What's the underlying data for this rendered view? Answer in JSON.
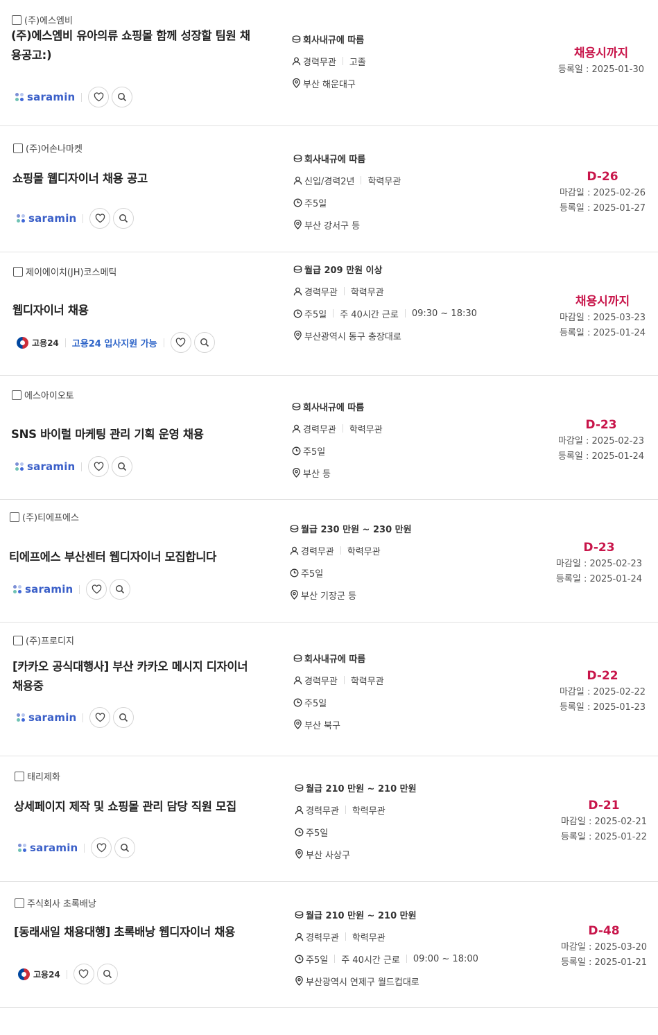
{
  "accent_color": "#c8154a",
  "jobs": [
    {
      "company": "(주)에스엠비",
      "title_lines": [
        "(주)에스엠비 유아의류 쇼핑몰 함께 성장할 팀원 채",
        "용공고:)"
      ],
      "source": "saramin",
      "source_label": "saramin",
      "salary": "회사내규에 따름",
      "career": "경력무관",
      "education": "고졸",
      "schedule": null,
      "location": "부산 해운대구",
      "dday": "채용시까지",
      "deadline": null,
      "registered": "등록일 : 2025-01-30"
    },
    {
      "company": "(주)어손나마켓",
      "title_lines": [
        "쇼핑몰 웹디자이너 채용 공고"
      ],
      "source": "saramin",
      "source_label": "saramin",
      "salary": "회사내규에 따름",
      "career": "신입/경력2년",
      "education": "학력무관",
      "schedule": [
        "주5일"
      ],
      "location": "부산 강서구 등",
      "dday": "D-26",
      "deadline": "마감일 : 2025-02-26",
      "registered": "등록일 : 2025-01-27"
    },
    {
      "company": "제이에이치(JH)코스메틱",
      "title_lines": [
        "웹디자이너 채용"
      ],
      "source": "goyong",
      "source_label": "고용24",
      "support_label": "고용24 입사지원 가능",
      "salary": "월급 209 만원 이상",
      "career": "경력무관",
      "education": "학력무관",
      "schedule": [
        "주5일",
        "주 40시간 근로",
        "09:30 ~ 18:30"
      ],
      "location": "부산광역시 동구 충장대로",
      "dday": "채용시까지",
      "deadline": "마감일 : 2025-03-23",
      "registered": "등록일 : 2025-01-24"
    },
    {
      "company": "에스아이오토",
      "title_lines": [
        "SNS 바이럴 마케팅 관리 기획 운영 채용"
      ],
      "source": "saramin",
      "source_label": "saramin",
      "salary": "회사내규에 따름",
      "career": "경력무관",
      "education": "학력무관",
      "schedule": [
        "주5일"
      ],
      "location": "부산 등",
      "dday": "D-23",
      "deadline": "마감일 : 2025-02-23",
      "registered": "등록일 : 2025-01-24"
    },
    {
      "company": "(주)티에프에스",
      "title_lines": [
        "티에프에스 부산센터 웹디자이너 모집합니다"
      ],
      "source": "saramin",
      "source_label": "saramin",
      "salary": "월급 230 만원 ~ 230 만원",
      "career": "경력무관",
      "education": "학력무관",
      "schedule": [
        "주5일"
      ],
      "location": "부산 기장군 등",
      "dday": "D-23",
      "deadline": "마감일 : 2025-02-23",
      "registered": "등록일 : 2025-01-24"
    },
    {
      "company": "(주)프로디지",
      "title_lines": [
        "[카카오 공식대행사] 부산 카카오 메시지 디자이너",
        "채용중"
      ],
      "source": "saramin",
      "source_label": "saramin",
      "salary": "회사내규에 따름",
      "career": "경력무관",
      "education": "학력무관",
      "schedule": [
        "주5일"
      ],
      "location": "부산 북구",
      "dday": "D-22",
      "deadline": "마감일 : 2025-02-22",
      "registered": "등록일 : 2025-01-23"
    },
    {
      "company": "태리제화",
      "title_lines": [
        "상세페이지 제작 및 쇼핑몰 관리 담당 직원 모집"
      ],
      "source": "saramin",
      "source_label": "saramin",
      "salary": "월급 210 만원 ~ 210 만원",
      "career": "경력무관",
      "education": "학력무관",
      "schedule": [
        "주5일"
      ],
      "location": "부산 사상구",
      "dday": "D-21",
      "deadline": "마감일 : 2025-02-21",
      "registered": "등록일 : 2025-01-22"
    },
    {
      "company": "주식회사 초록배낭",
      "title_lines": [
        "[동래새일 채용대행] 초록배낭 웹디자이너 채용"
      ],
      "source": "goyong",
      "source_label": "고용24",
      "salary": "월급 210 만원 ~ 210 만원",
      "career": "경력무관",
      "education": "학력무관",
      "schedule": [
        "주5일",
        "주 40시간 근로",
        "09:00 ~ 18:00"
      ],
      "location": "부산광역시 연제구 월드컵대로",
      "dday": "D-48",
      "deadline": "마감일 : 2025-03-20",
      "registered": "등록일 : 2025-01-21"
    }
  ]
}
